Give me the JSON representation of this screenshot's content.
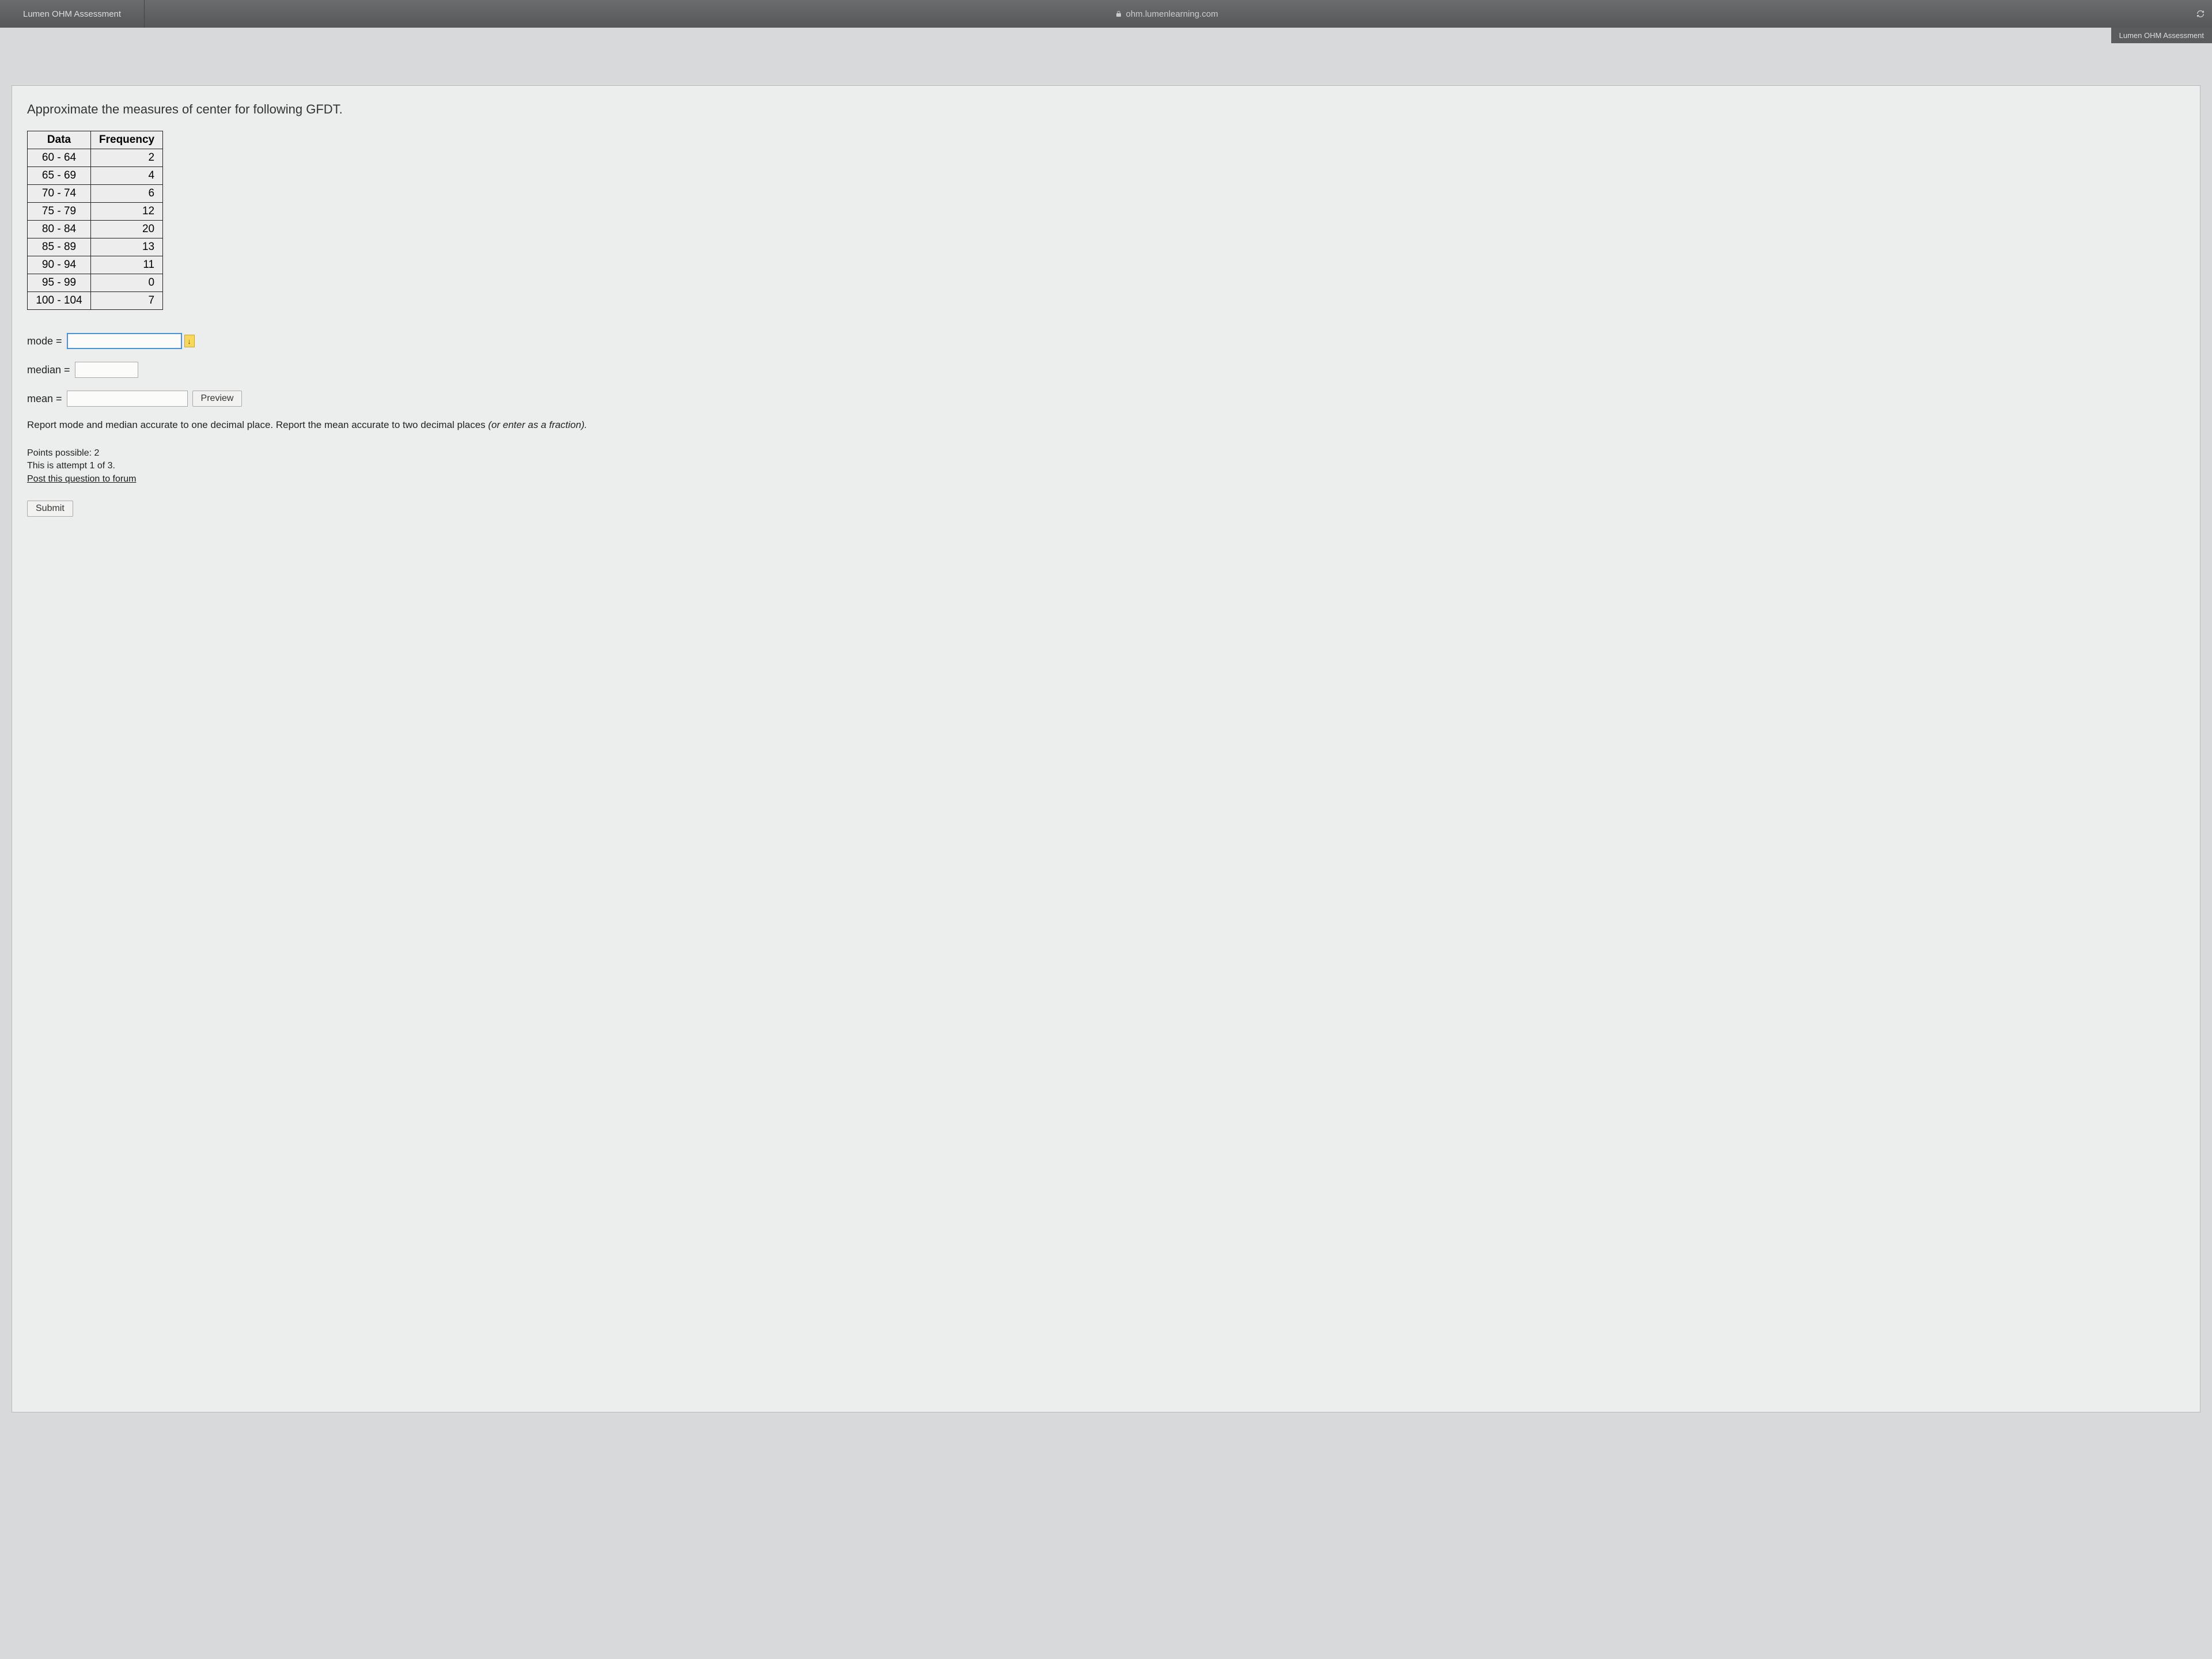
{
  "browser": {
    "tab_title": "Lumen OHM Assessment",
    "address": "ohm.lumenlearning.com",
    "next_tab": "Lumen OHM Assessment"
  },
  "question": {
    "prompt": "Approximate the measures of center for following GFDT.",
    "table": {
      "headers": [
        "Data",
        "Frequency"
      ],
      "rows": [
        {
          "data": "60 - 64",
          "freq": "2"
        },
        {
          "data": "65 - 69",
          "freq": "4"
        },
        {
          "data": "70 - 74",
          "freq": "6"
        },
        {
          "data": "75 - 79",
          "freq": "12"
        },
        {
          "data": "80 - 84",
          "freq": "20"
        },
        {
          "data": "85 - 89",
          "freq": "13"
        },
        {
          "data": "90 - 94",
          "freq": "11"
        },
        {
          "data": "95 - 99",
          "freq": "0"
        },
        {
          "data": "100 - 104",
          "freq": "7"
        }
      ]
    },
    "inputs": {
      "mode_label": "mode =",
      "mode_value": "",
      "median_label": "median =",
      "median_value": "",
      "mean_label": "mean =",
      "mean_value": "",
      "preview_label": "Preview"
    },
    "instructions_plain": "Report mode and median accurate to one decimal place. Report the mean accurate to two decimal places ",
    "instructions_italic": "(or enter as a fraction).",
    "meta": {
      "points": "Points possible: 2",
      "attempt": "This is attempt 1 of 3.",
      "forum_link": "Post this question to forum"
    },
    "submit_label": "Submit"
  }
}
